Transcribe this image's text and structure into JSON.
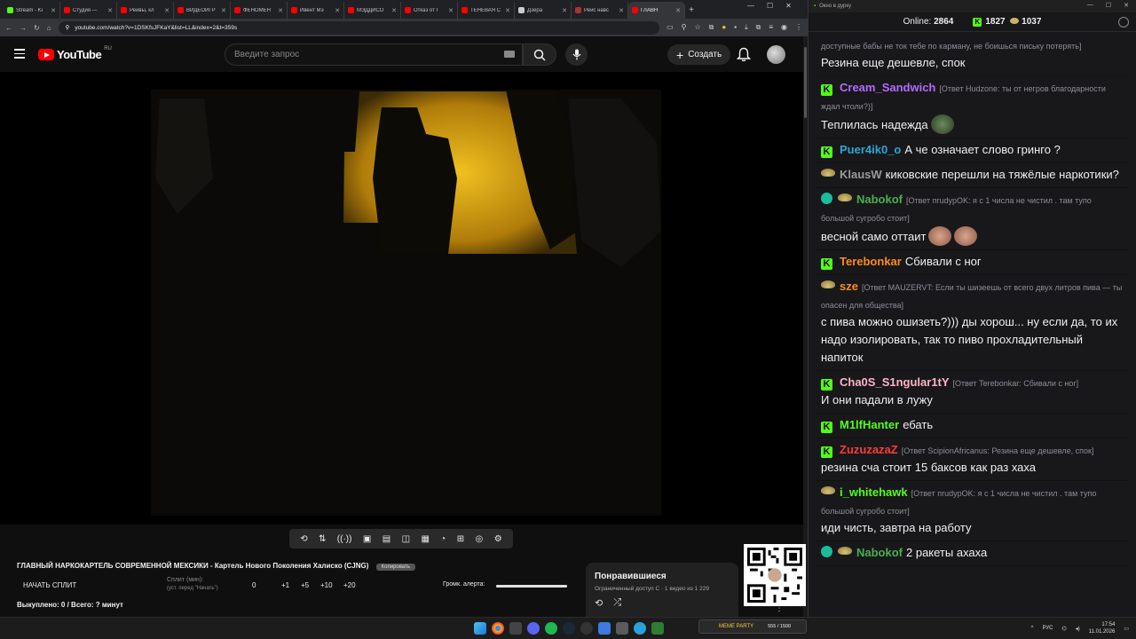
{
  "browser": {
    "tabs": [
      {
        "label": "Stream - Ki",
        "color": "#53fc18"
      },
      {
        "label": "Студия —",
        "color": "#ff0000"
      },
      {
        "label": "Рейвы, кл",
        "color": "#ff0000"
      },
      {
        "label": "ВИДЕОИГР",
        "color": "#ff0000"
      },
      {
        "label": "ФЕНОМЕН",
        "color": "#ff0000"
      },
      {
        "label": "Ивент Мэ",
        "color": "#ff0000"
      },
      {
        "label": "МЭДДИСО",
        "color": "#ff0000"
      },
      {
        "label": "Отказ от I",
        "color": "#ff0000"
      },
      {
        "label": "ТЕНЕВАЯ С",
        "color": "#ff0000"
      },
      {
        "label": "Дзёра",
        "color": "#cccccc"
      },
      {
        "label": "Рейс навс",
        "color": "#a33"
      },
      {
        "label": "ГЛАВН",
        "color": "#ff0000"
      }
    ],
    "new_tab": "+",
    "url": "youtube.com/watch?v=1DSKfsJFKaY&list=LL&index=2&t=359s"
  },
  "youtube": {
    "logo_text": "YouTube",
    "country": "RU",
    "search_placeholder": "Введите запрос",
    "create_label": "Создать"
  },
  "player": {
    "title": "ГЛАВНЫЙ НАРКОКАРТЕЛЬ СОВРЕМЕННОЙ МЕКСИКИ - Картель Нового Поколения Халиско (CJNG)",
    "badge": "Копировать",
    "start_split": "НАЧАТЬ СПЛИТ",
    "split_label": "Сплит (мин):",
    "split_hint": "(уст. перед \"Начать\")",
    "split_value": "0",
    "increments": [
      "+1",
      "+5",
      "+10",
      "+20"
    ],
    "alert_label": "Громк. алерта:",
    "alert_level": 1.0,
    "bought": "Выкуплено: 0 / Всего: ? минут"
  },
  "liked": {
    "title": "Понравившиеся",
    "subtitle": "Ограниченный доступ С · 1 видео из 1 229"
  },
  "chat": {
    "window_title": "Окно в дурку",
    "online_label": "Online:",
    "online_value": "2864",
    "k_count": "1827",
    "hat_count": "1037",
    "messages": [
      {
        "badge": "",
        "user": "",
        "color": "#efeff1",
        "reply": "доступные бабы не ток тебе по карману, не боишься письку потерять]",
        "text": "Резина еще дешевле, спок"
      },
      {
        "badge": "k",
        "user": "Cream_Sandwich",
        "color": "#b36bff",
        "reply": "[Ответ Hudzone: ты от негров благодарности ждал чтоли?)]",
        "text": "Теплилась надежда"
      },
      {
        "badge": "k",
        "user": "Puer4ik0_o",
        "color": "#28a8d6",
        "reply": "",
        "text": "А че означает слово гринго ?"
      },
      {
        "badge": "hat",
        "user": "KlausW",
        "color": "#9a9a9a",
        "reply": "",
        "text": "киковские перешли на тяжёлые наркотики?"
      },
      {
        "badge": "vhat",
        "user": "Nabokof",
        "color": "#4caf50",
        "reply": "[Ответ пrudуpOK: я с 1 числа не чистил . там тупо большой сугробо стоит]",
        "text": "весной само оттаит"
      },
      {
        "badge": "k",
        "user": "Terebonkar",
        "color": "#ff8c1a",
        "reply": "",
        "text": "Сбивали с ног"
      },
      {
        "badge": "hat",
        "user": "sze",
        "color": "#ff8c1a",
        "reply": "[Ответ MAUZERVT: Если ты шизеешь от всего двух литров пива — ты опасен для общества]",
        "text": "с пива можно ошизеть?))) ды хорош... ну если да, то их надо изолировать, так то пиво прохладительный напиток"
      },
      {
        "badge": "k",
        "user": "Cha0S_S1ngular1tY",
        "color": "#ffb3c6",
        "reply": "[Ответ Terebonkar: Сбивали с ног]",
        "text": "И они падали в лужу"
      },
      {
        "badge": "k",
        "user": "M1lfHanter",
        "color": "#53fc18",
        "reply": "",
        "text": "ебать"
      },
      {
        "badge": "k",
        "user": "ZuzuzazaZ",
        "color": "#ff3b3b",
        "reply": "[Ответ ScipionAfricanus: Резина еще дешевле, спок]",
        "text": "резина сча стоит 15 баксов как раз хаха"
      },
      {
        "badge": "hat",
        "user": "i_whitehawk",
        "color": "#53fc18",
        "reply": "[Ответ пrudуpOK: я с 1 числа не чистил . там тупо большой сугробо стоит]",
        "text": "иди чисть, завтра на работу"
      },
      {
        "badge": "vhat",
        "user": "Nabokof",
        "color": "#4caf50",
        "reply": "",
        "text": "2 ракеты ахаха"
      }
    ]
  },
  "taskbar": {
    "meme_label": "MEME PARTY",
    "meme_count": "555 / 1500",
    "lang": "РУС",
    "time": "17:54",
    "date": "11.01.2026"
  }
}
